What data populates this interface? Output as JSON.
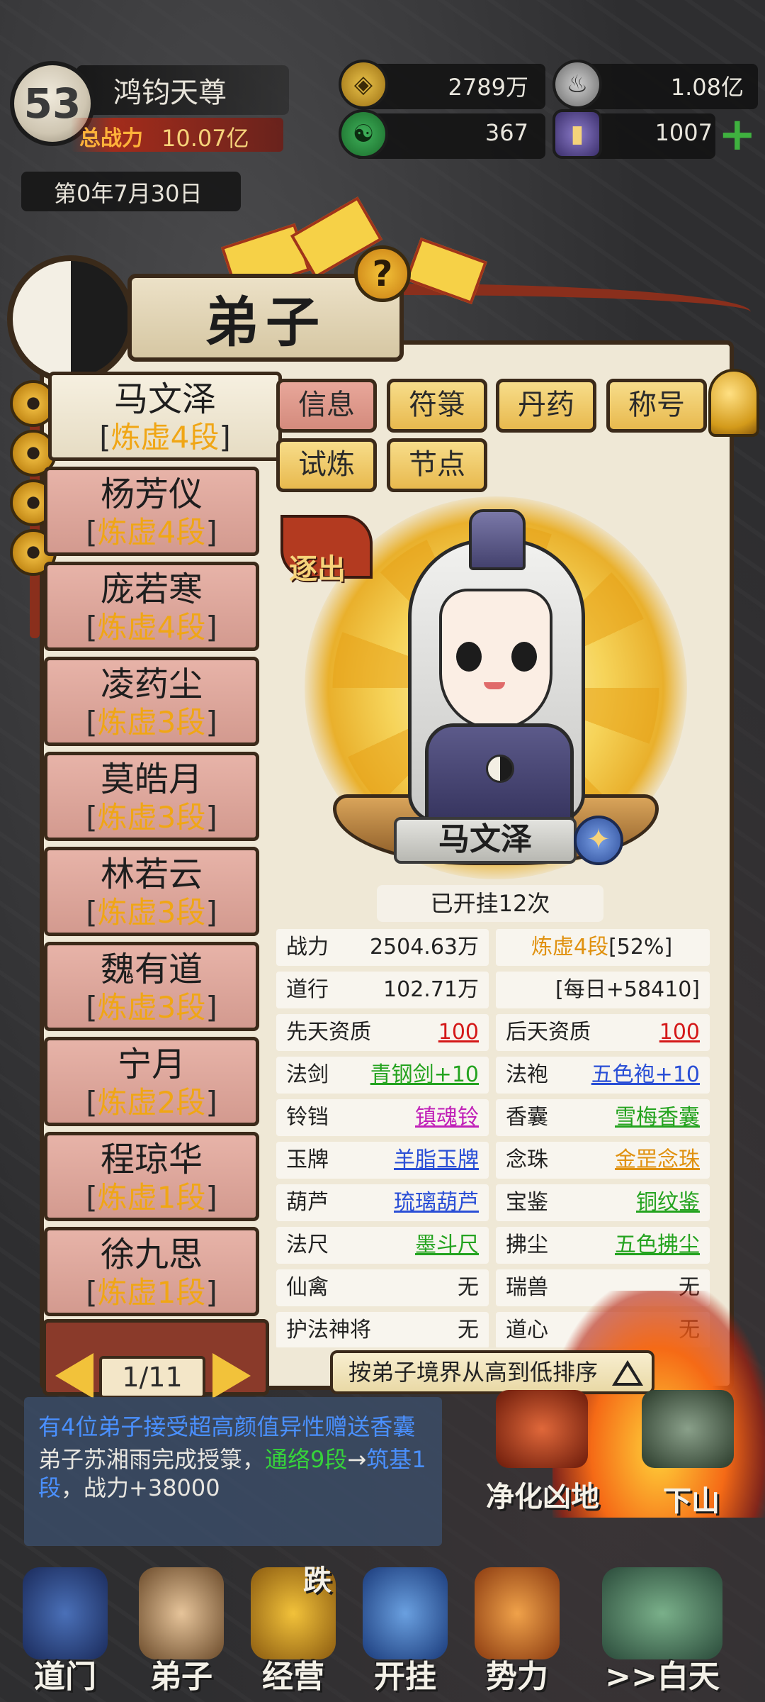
{
  "player": {
    "level": "53",
    "name": "鸿钧天尊",
    "power_label": "总战力",
    "power_value": "10.07亿",
    "date": "第0年7月30日"
  },
  "resources": {
    "coins": "2789万",
    "incense": "1.08亿",
    "jade": "367",
    "talisman": "1007"
  },
  "panel": {
    "title": "弟子",
    "help_label": "?"
  },
  "disciples": [
    {
      "name": "马文泽",
      "rank": "炼虚4段"
    },
    {
      "name": "杨芳仪",
      "rank": "炼虚4段"
    },
    {
      "name": "庞若寒",
      "rank": "炼虚4段"
    },
    {
      "name": "凌药尘",
      "rank": "炼虚3段"
    },
    {
      "name": "莫皓月",
      "rank": "炼虚3段"
    },
    {
      "name": "林若云",
      "rank": "炼虚3段"
    },
    {
      "name": "魏有道",
      "rank": "炼虚3段"
    },
    {
      "name": "宁月",
      "rank": "炼虚2段"
    },
    {
      "name": "程琼华",
      "rank": "炼虚1段"
    },
    {
      "name": "徐九思",
      "rank": "炼虚1段"
    }
  ],
  "pager": {
    "text": "1/11"
  },
  "tabs": [
    "信息",
    "符箓",
    "丹药",
    "称号",
    "试炼",
    "节点"
  ],
  "detail": {
    "expel_label": "逐出",
    "name": "马文泽",
    "hang_count": "已开挂12次",
    "stats": {
      "power_label": "战力",
      "power_value": "2504.63万",
      "realm_value": "炼虚4段",
      "realm_pct": "[52%]",
      "dao_label": "道行",
      "dao_value": "102.71万",
      "daily_value": "[每日+58410]",
      "innate_label": "先天资质",
      "innate_value": "100",
      "acquired_label": "后天资质",
      "acquired_value": "100",
      "sword_label": "法剑",
      "sword_value": "青钢剑+10",
      "robe_label": "法袍",
      "robe_value": "五色袍+10",
      "bell_label": "铃铛",
      "bell_value": "镇魂铃",
      "sachet_label": "香囊",
      "sachet_value": "雪梅香囊",
      "jade_label": "玉牌",
      "jade_value": "羊脂玉牌",
      "beads_label": "念珠",
      "beads_value": "金罡念珠",
      "gourd_label": "葫芦",
      "gourd_value": "琉璃葫芦",
      "mirror_label": "宝鉴",
      "mirror_value": "铜纹鉴",
      "ruler_label": "法尺",
      "ruler_value": "墨斗尺",
      "whisk_label": "拂尘",
      "whisk_value": "五色拂尘",
      "bird_label": "仙禽",
      "bird_value": "无",
      "beast_label": "瑞兽",
      "beast_value": "无",
      "general_label": "护法神将",
      "general_value": "无",
      "heart_label": "道心",
      "heart_value": "无"
    }
  },
  "sort_button": "按弟子境界从高到低排序",
  "log": {
    "msg1": "有4位弟子接受超高颜值异性赠送香囊",
    "msg2_a": "弟子苏湘雨完成授箓，",
    "msg2_b": "通络9段",
    "msg2_c": "→",
    "msg2_d": "筑基1段",
    "msg2_e": "，战力+38000"
  },
  "actions": {
    "purify": "净化凶地",
    "descend": "下山"
  },
  "nav": {
    "items": [
      "道门",
      "弟子",
      "经营",
      "开挂",
      "势力",
      ">>白天"
    ],
    "fall_label": "跌"
  },
  "colors": {
    "rank_gold": "#f0a615",
    "green": "#24a31f",
    "blue": "#2a4fd6",
    "magenta": "#c020b8",
    "orange": "#e0910f",
    "red": "#d41818"
  }
}
